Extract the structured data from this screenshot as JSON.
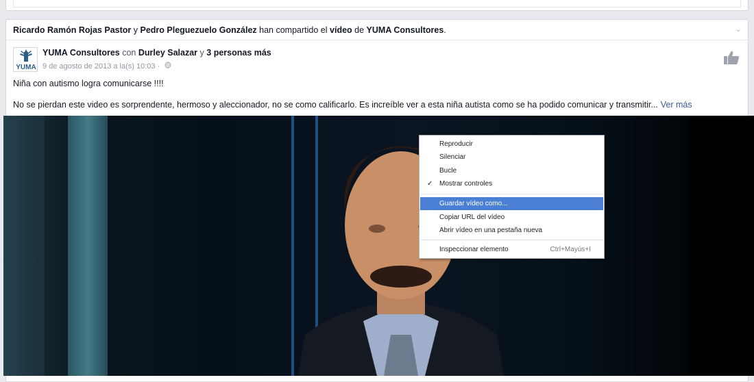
{
  "story": {
    "header": {
      "actor1": "Ricardo Ramón Rojas Pastor",
      "joiner": "y",
      "actor2": "Pedro Pleguezuelo González",
      "verb": "han compartido el",
      "object": "vídeo",
      "prep": "de",
      "page": "YUMA Consultores",
      "period": "."
    },
    "avatar_text": "YUMA",
    "author": "YUMA Consultores",
    "with_word": "con",
    "tagged": "Durley Salazar",
    "and_word": "y",
    "others": "3 personas más",
    "timestamp": "9 de agosto de 2013 a la(s) 10:03",
    "separator": "·",
    "title": "Niña con autismo logra comunicarse !!!!",
    "body": "No se pierdan este video es sorprendente, hermoso y aleccionador, no se como calificarlo. Es increíble ver a esta niña autista como se ha podido comunicar y transmitir...",
    "see_more": "Ver más"
  },
  "context_menu": {
    "items": [
      {
        "label": "Reproducir",
        "checked": false,
        "active": false
      },
      {
        "label": "Silenciar",
        "checked": false,
        "active": false
      },
      {
        "label": "Bucle",
        "checked": false,
        "active": false
      },
      {
        "label": "Mostrar controles",
        "checked": true,
        "active": false
      },
      {
        "label": "Guardar vídeo como...",
        "checked": false,
        "active": true
      },
      {
        "label": "Copiar URL del vídeo",
        "checked": false,
        "active": false
      },
      {
        "label": "Abrir vídeo en una pestaña nueva",
        "checked": false,
        "active": false
      },
      {
        "label": "Inspeccionar elemento",
        "checked": false,
        "active": false
      }
    ],
    "check_glyph": "✓",
    "inspect_shortcut": "Ctrl+Mayús+I"
  },
  "colors": {
    "link": "#3b5998",
    "highlight": "#4a7fd4"
  }
}
